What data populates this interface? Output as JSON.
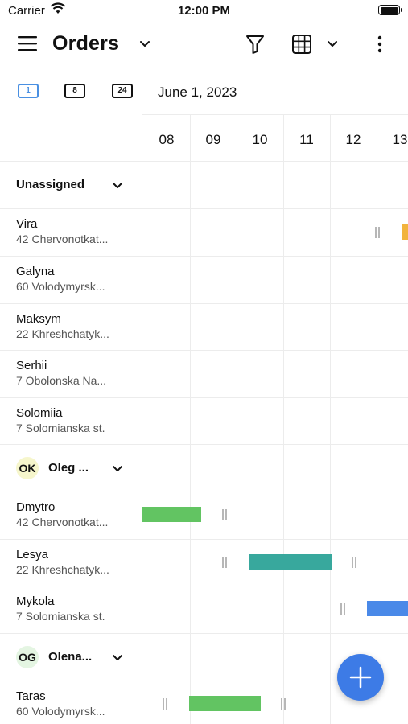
{
  "status_bar": {
    "carrier": "Carrier",
    "time": "12:00 PM"
  },
  "app_bar": {
    "title": "Orders"
  },
  "zoom": {
    "day": "1",
    "week": "8",
    "full": "24"
  },
  "timeline": {
    "date": "June 1, 2023",
    "hours": [
      "08",
      "09",
      "10",
      "11",
      "12",
      "13"
    ]
  },
  "groups": [
    {
      "title": "Unassigned",
      "rows": [
        {
          "name": "Vira",
          "address": "42 Chervonotkat..."
        },
        {
          "name": "Galyna",
          "address": "60 Volodymyrsk..."
        },
        {
          "name": "Maksym",
          "address": "22 Khreshchatyk..."
        },
        {
          "name": "Serhii",
          "address": "7 Obolonska Na..."
        },
        {
          "name": "Solomiia",
          "address": "7 Solomianska st."
        }
      ]
    },
    {
      "title": "Oleg ...",
      "initials": "OK",
      "avatar_color": "#f6f6cc",
      "rows": [
        {
          "name": "Dmytro",
          "address": "42 Chervonotkat..."
        },
        {
          "name": "Lesya",
          "address": "22 Khreshchatyk..."
        },
        {
          "name": "Mykola",
          "address": "7 Solomianska st."
        }
      ]
    },
    {
      "title": "Olena...",
      "initials": "OG",
      "avatar_color": "#e4f5e2",
      "rows": [
        {
          "name": "Taras",
          "address": "60 Volodymyrsk..."
        }
      ]
    }
  ],
  "colors": {
    "accent": "#4a90e2",
    "fab": "#3d7be6",
    "order_green": "#62c462",
    "order_teal": "#38a89d",
    "order_blue": "#4a89e8",
    "order_yellow": "#f2b33d"
  },
  "icons": [
    "menu-icon",
    "chevron-down-icon",
    "filter-icon",
    "grid-icon",
    "more-vertical-icon",
    "plus-icon",
    "wifi-icon",
    "battery-icon"
  ]
}
